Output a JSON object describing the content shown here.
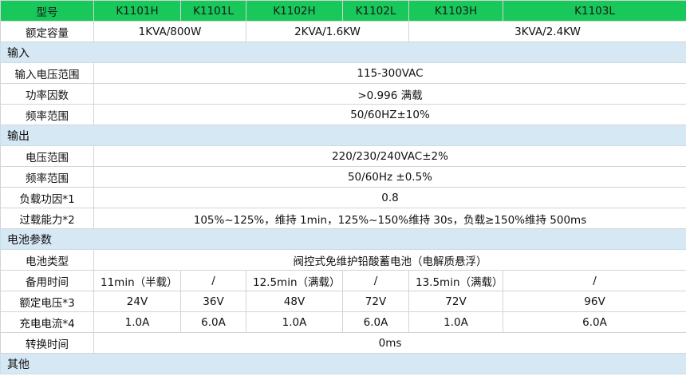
{
  "header": {
    "model_label": "型号",
    "models": [
      "K1101H",
      "K1101L",
      "K1102H",
      "K1102L",
      "K1103H",
      "K1103L"
    ]
  },
  "capacity": {
    "label": "额定容量",
    "values": [
      "1KVA/800W",
      "2KVA/1.6KW",
      "3KVA/2.4KW"
    ]
  },
  "input": {
    "section": "输入",
    "voltage_range": {
      "label": "输入电压范围",
      "value": "115-300VAC"
    },
    "power_factor": {
      "label": "功率因数",
      "value": ">0.996  满载"
    },
    "frequency_range": {
      "label": "频率范围",
      "value": "50/60HZ±10%"
    }
  },
  "output": {
    "section": "输出",
    "voltage_range": {
      "label": "电压范围",
      "value": "220/230/240VAC±2%"
    },
    "frequency_range": {
      "label": "频率范围",
      "value": "50/60Hz  ±0.5%"
    },
    "load_pf": {
      "label": "负载功因*1",
      "value": "0.8"
    },
    "overload": {
      "label": "过载能力*2",
      "value": "105%~125%，维持 1min，125%~150%维持 30s，负载≥150%维持 500ms"
    }
  },
  "battery": {
    "section": "电池参数",
    "type": {
      "label": "电池类型",
      "value": "阀控式免维护铅酸蓄电池（电解质悬浮）"
    },
    "backup_time": {
      "label": "备用时间",
      "values": [
        "11min（半载）",
        "/",
        "12.5min（满载）",
        "/",
        "13.5min（满载）",
        "/"
      ]
    },
    "rated_voltage": {
      "label": "额定电压*3",
      "values": [
        "24V",
        "36V",
        "48V",
        "72V",
        "72V",
        "96V"
      ]
    },
    "charge_current": {
      "label": "充电电流*4",
      "values": [
        "1.0A",
        "6.0A",
        "1.0A",
        "6.0A",
        "1.0A",
        "6.0A"
      ]
    },
    "transfer_time": {
      "label": "转换时间",
      "value": "0ms"
    }
  },
  "other": {
    "section": "其他"
  }
}
